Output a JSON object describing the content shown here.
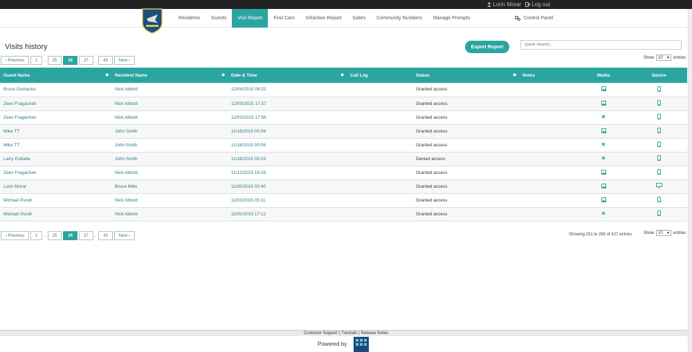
{
  "topbar": {
    "user_label": "Lorin Morar",
    "logout_label": "Log out"
  },
  "nav": {
    "items": [
      "Residents",
      "Guests",
      "Visit Report",
      "Find Cars",
      "Infraction Report",
      "Gates",
      "Community Numbers",
      "Manage Prompts"
    ],
    "active": "Visit Report",
    "control_panel": "Control Panel"
  },
  "page": {
    "title": "Visits history",
    "export_label": "Export Report",
    "search_placeholder": "Quick Search..."
  },
  "pagination": {
    "prev": "‹ Previous",
    "next": "Next ›",
    "pages": [
      "1",
      "25",
      "26",
      "27",
      "43"
    ],
    "dots": "..",
    "current": "26"
  },
  "show_entries": {
    "show": "Show",
    "value": "10",
    "entries": "entries"
  },
  "table": {
    "columns": [
      "Guest Name",
      "Resident Name",
      "Date & Time",
      "Call Log",
      "Status",
      "Notes",
      "Media",
      "Device"
    ],
    "rows": [
      {
        "guest": "Bruce Gamache",
        "resident": "Nick Abbott",
        "datetime": "12/04/2015 09:22",
        "status": "Granted access",
        "media": "image-icon",
        "device": "mobile-icon"
      },
      {
        "guest": "Zeev Fragachan",
        "resident": "Nick Abbott",
        "datetime": "12/03/2015 17:57",
        "status": "Granted access",
        "media": "image-icon",
        "device": "mobile-icon"
      },
      {
        "guest": "Zeev Fragachan",
        "resident": "Nick Abbott",
        "datetime": "12/03/2015 17:56",
        "status": "Granted access",
        "media": "no-media-icon",
        "device": "mobile-icon"
      },
      {
        "guest": "Mike TT",
        "resident": "John Smith",
        "datetime": "11/16/2015 05:08",
        "status": "Granted access",
        "media": "image-icon",
        "device": "mobile-icon"
      },
      {
        "guest": "Mike TT",
        "resident": "John Smith",
        "datetime": "11/16/2015 05:06",
        "status": "Granted access",
        "media": "no-media-icon",
        "device": "mobile-icon"
      },
      {
        "guest": "Larry Estlada",
        "resident": "John Smith",
        "datetime": "11/16/2015 05:03",
        "status": "Denied access",
        "media": "no-media-icon",
        "device": "mobile-icon"
      },
      {
        "guest": "Zeev Fragachan",
        "resident": "Nick Abbott",
        "datetime": "11/12/2015 16:28",
        "status": "Granted access",
        "media": "image-icon",
        "device": "mobile-icon"
      },
      {
        "guest": "Lorin Morar",
        "resident": "Bruce Mike",
        "datetime": "11/05/2015 02:40",
        "status": "Granted access",
        "media": "image-icon",
        "device": "desktop-icon"
      },
      {
        "guest": "Michael Purell",
        "resident": "Nick Abbott",
        "datetime": "11/03/2015 05:11",
        "status": "Granted access",
        "media": "image-icon",
        "device": "mobile-icon"
      },
      {
        "guest": "Michael Purell",
        "resident": "Nick Abbott",
        "datetime": "11/02/2015 17:12",
        "status": "Granted access",
        "media": "no-media-icon",
        "device": "mobile-icon"
      }
    ]
  },
  "info": "Showing 251 to 260 of 427 entries",
  "footer": {
    "links": [
      "Customer Support",
      "Tutorials",
      "Release Notes"
    ],
    "sep": "|",
    "powered_by": "Powered by"
  },
  "colors": {
    "accent": "#2aa5a0",
    "topbar": "#222222",
    "link": "#2a7b8a"
  }
}
